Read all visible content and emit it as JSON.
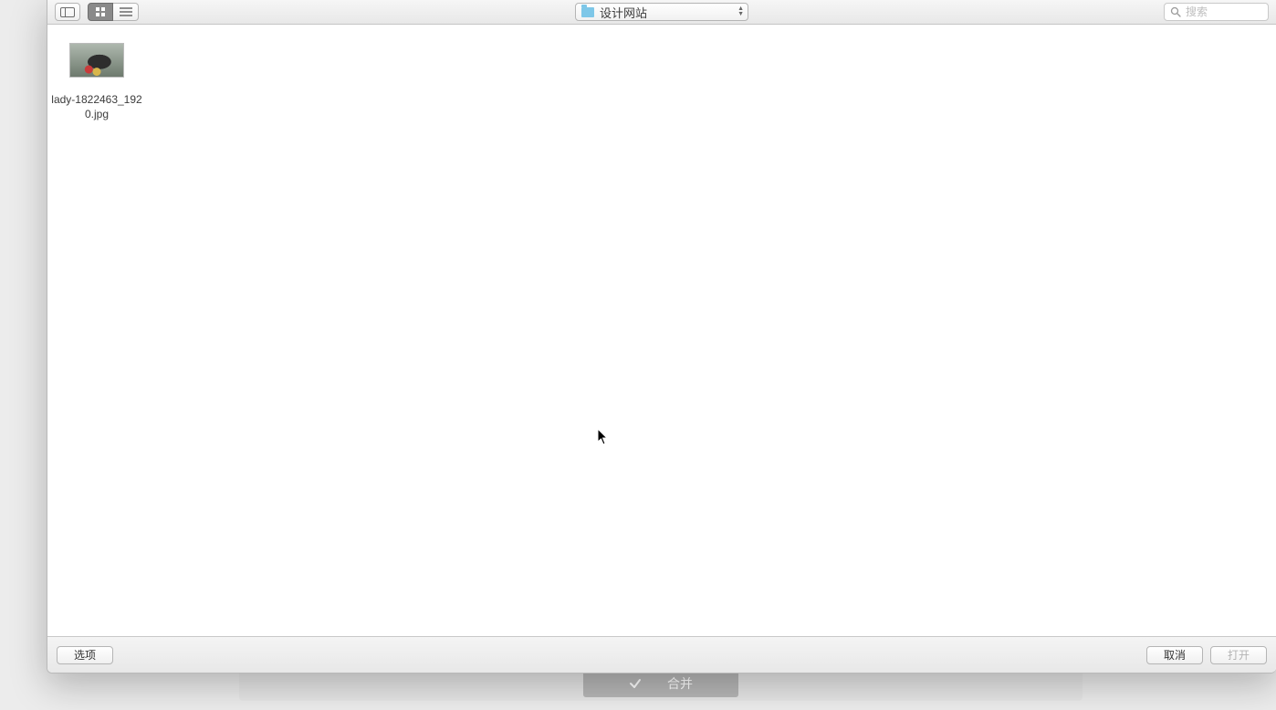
{
  "toolbar": {
    "folder_name": "设计网站",
    "search_placeholder": "搜索"
  },
  "files": [
    {
      "name": "lady-1822463_1920.jpg"
    }
  ],
  "footer": {
    "options_label": "选项",
    "cancel_label": "取消",
    "open_label": "打开"
  },
  "background": {
    "merge_label": "合并"
  }
}
